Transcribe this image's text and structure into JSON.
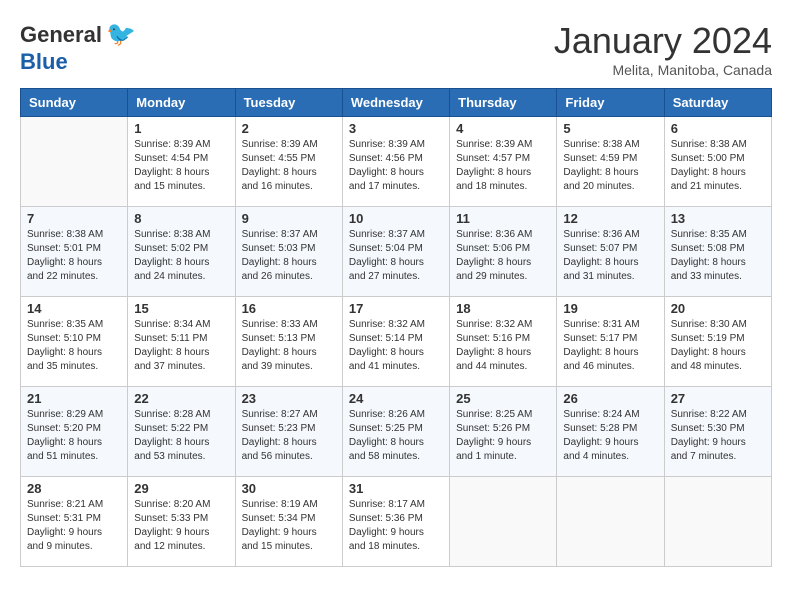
{
  "header": {
    "logo_general": "General",
    "logo_blue": "Blue",
    "month_title": "January 2024",
    "location": "Melita, Manitoba, Canada"
  },
  "days_of_week": [
    "Sunday",
    "Monday",
    "Tuesday",
    "Wednesday",
    "Thursday",
    "Friday",
    "Saturday"
  ],
  "weeks": [
    [
      {
        "day": "",
        "info": ""
      },
      {
        "day": "1",
        "info": "Sunrise: 8:39 AM\nSunset: 4:54 PM\nDaylight: 8 hours\nand 15 minutes."
      },
      {
        "day": "2",
        "info": "Sunrise: 8:39 AM\nSunset: 4:55 PM\nDaylight: 8 hours\nand 16 minutes."
      },
      {
        "day": "3",
        "info": "Sunrise: 8:39 AM\nSunset: 4:56 PM\nDaylight: 8 hours\nand 17 minutes."
      },
      {
        "day": "4",
        "info": "Sunrise: 8:39 AM\nSunset: 4:57 PM\nDaylight: 8 hours\nand 18 minutes."
      },
      {
        "day": "5",
        "info": "Sunrise: 8:38 AM\nSunset: 4:59 PM\nDaylight: 8 hours\nand 20 minutes."
      },
      {
        "day": "6",
        "info": "Sunrise: 8:38 AM\nSunset: 5:00 PM\nDaylight: 8 hours\nand 21 minutes."
      }
    ],
    [
      {
        "day": "7",
        "info": "Sunrise: 8:38 AM\nSunset: 5:01 PM\nDaylight: 8 hours\nand 22 minutes."
      },
      {
        "day": "8",
        "info": "Sunrise: 8:38 AM\nSunset: 5:02 PM\nDaylight: 8 hours\nand 24 minutes."
      },
      {
        "day": "9",
        "info": "Sunrise: 8:37 AM\nSunset: 5:03 PM\nDaylight: 8 hours\nand 26 minutes."
      },
      {
        "day": "10",
        "info": "Sunrise: 8:37 AM\nSunset: 5:04 PM\nDaylight: 8 hours\nand 27 minutes."
      },
      {
        "day": "11",
        "info": "Sunrise: 8:36 AM\nSunset: 5:06 PM\nDaylight: 8 hours\nand 29 minutes."
      },
      {
        "day": "12",
        "info": "Sunrise: 8:36 AM\nSunset: 5:07 PM\nDaylight: 8 hours\nand 31 minutes."
      },
      {
        "day": "13",
        "info": "Sunrise: 8:35 AM\nSunset: 5:08 PM\nDaylight: 8 hours\nand 33 minutes."
      }
    ],
    [
      {
        "day": "14",
        "info": "Sunrise: 8:35 AM\nSunset: 5:10 PM\nDaylight: 8 hours\nand 35 minutes."
      },
      {
        "day": "15",
        "info": "Sunrise: 8:34 AM\nSunset: 5:11 PM\nDaylight: 8 hours\nand 37 minutes."
      },
      {
        "day": "16",
        "info": "Sunrise: 8:33 AM\nSunset: 5:13 PM\nDaylight: 8 hours\nand 39 minutes."
      },
      {
        "day": "17",
        "info": "Sunrise: 8:32 AM\nSunset: 5:14 PM\nDaylight: 8 hours\nand 41 minutes."
      },
      {
        "day": "18",
        "info": "Sunrise: 8:32 AM\nSunset: 5:16 PM\nDaylight: 8 hours\nand 44 minutes."
      },
      {
        "day": "19",
        "info": "Sunrise: 8:31 AM\nSunset: 5:17 PM\nDaylight: 8 hours\nand 46 minutes."
      },
      {
        "day": "20",
        "info": "Sunrise: 8:30 AM\nSunset: 5:19 PM\nDaylight: 8 hours\nand 48 minutes."
      }
    ],
    [
      {
        "day": "21",
        "info": "Sunrise: 8:29 AM\nSunset: 5:20 PM\nDaylight: 8 hours\nand 51 minutes."
      },
      {
        "day": "22",
        "info": "Sunrise: 8:28 AM\nSunset: 5:22 PM\nDaylight: 8 hours\nand 53 minutes."
      },
      {
        "day": "23",
        "info": "Sunrise: 8:27 AM\nSunset: 5:23 PM\nDaylight: 8 hours\nand 56 minutes."
      },
      {
        "day": "24",
        "info": "Sunrise: 8:26 AM\nSunset: 5:25 PM\nDaylight: 8 hours\nand 58 minutes."
      },
      {
        "day": "25",
        "info": "Sunrise: 8:25 AM\nSunset: 5:26 PM\nDaylight: 9 hours\nand 1 minute."
      },
      {
        "day": "26",
        "info": "Sunrise: 8:24 AM\nSunset: 5:28 PM\nDaylight: 9 hours\nand 4 minutes."
      },
      {
        "day": "27",
        "info": "Sunrise: 8:22 AM\nSunset: 5:30 PM\nDaylight: 9 hours\nand 7 minutes."
      }
    ],
    [
      {
        "day": "28",
        "info": "Sunrise: 8:21 AM\nSunset: 5:31 PM\nDaylight: 9 hours\nand 9 minutes."
      },
      {
        "day": "29",
        "info": "Sunrise: 8:20 AM\nSunset: 5:33 PM\nDaylight: 9 hours\nand 12 minutes."
      },
      {
        "day": "30",
        "info": "Sunrise: 8:19 AM\nSunset: 5:34 PM\nDaylight: 9 hours\nand 15 minutes."
      },
      {
        "day": "31",
        "info": "Sunrise: 8:17 AM\nSunset: 5:36 PM\nDaylight: 9 hours\nand 18 minutes."
      },
      {
        "day": "",
        "info": ""
      },
      {
        "day": "",
        "info": ""
      },
      {
        "day": "",
        "info": ""
      }
    ]
  ]
}
